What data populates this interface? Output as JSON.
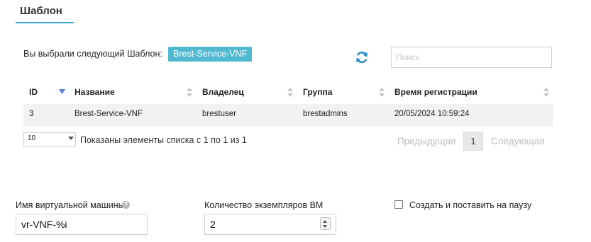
{
  "tab": {
    "title": "Шаблон"
  },
  "selection": {
    "label": "Вы выбрали следующий Шаблон:",
    "value": "Brest-Service-VNF"
  },
  "search": {
    "placeholder": "Поиск",
    "value": ""
  },
  "table": {
    "columns": [
      "ID",
      "Название",
      "Владелец",
      "Группа",
      "Время регистрации"
    ],
    "sorted_column": "ID",
    "rows": [
      [
        "3",
        "Brest-Service-VNF",
        "brestuser",
        "brestadmins",
        "20/05/2024 10:59:24"
      ]
    ]
  },
  "pagination": {
    "per_page": "10",
    "info": "Показаны элементы списка с 1 по 1 из 1",
    "prev": "Предыдущая",
    "current_page": "1",
    "next": "Следующая"
  },
  "form": {
    "vm_name_label": "Имя виртуальной машины",
    "vm_name_value": "vr-VNF-%i",
    "instances_label": "Количество экземпляров ВМ",
    "instances_value": "2",
    "hold_label": "Создать и поставить на паузу",
    "hold_checked": false
  },
  "icons": {
    "refresh": "refresh-icon",
    "help": "question-circle-icon",
    "sort": "sort-icon"
  },
  "colors": {
    "accent": "#3fa9d6",
    "badge": "#4fb9cf",
    "refresh": "#2b8fc5",
    "sort_active": "#5b7fd8"
  }
}
